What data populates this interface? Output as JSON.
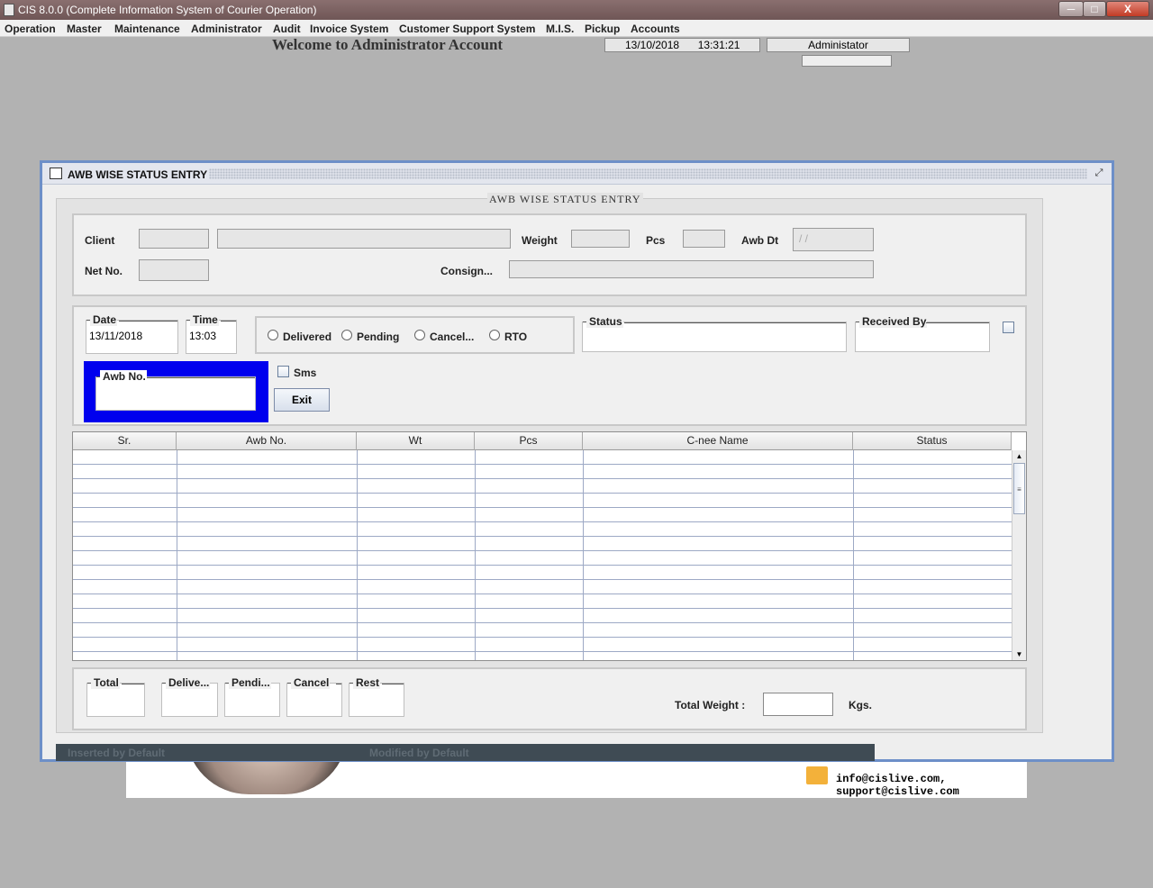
{
  "window": {
    "title": "CIS 8.0.0 (Complete Information System of Courier Operation)",
    "minimize": "─",
    "maximize": "□",
    "close": "X"
  },
  "menu": [
    "Operation",
    "Master",
    "Maintenance",
    "Administrator",
    "Audit",
    "Invoice System",
    "Customer Support System",
    "M.I.S.",
    "Pickup",
    "Accounts"
  ],
  "header": {
    "welcome": "Welcome to Administrator Account",
    "date": "13/10/2018",
    "time": "13:31:21",
    "user": "Administator"
  },
  "banner": {
    "email": "info@cislive.com, support@cislive.com"
  },
  "frame": {
    "title": "AWB WISE STATUS ENTRY",
    "restore": "⤢",
    "group_title": "AWB WISE STATUS ENTRY"
  },
  "details": {
    "client_label": "Client",
    "weight_label": "Weight",
    "pcs_label": "Pcs",
    "awbdt_label": "Awb  Dt",
    "awbdt_value": " / /",
    "netno_label": "Net No.",
    "consign_label": "Consign..."
  },
  "entry": {
    "date_label": "Date",
    "date_value": "13/11/2018",
    "time_label": "Time",
    "time_value": "13:03",
    "radios": [
      "Delivered",
      "Pending",
      "Cancel...",
      "RTO"
    ],
    "status_label": "Status",
    "received_by_label": "Received By",
    "awb_label": "Awb No.",
    "sms_label": "Sms",
    "exit_label": "Exit"
  },
  "table": {
    "columns": [
      "Sr.",
      "Awb No.",
      "Wt",
      "Pcs",
      "C-nee Name",
      "Status"
    ],
    "rows": [],
    "scroll_up": "▲",
    "scroll_down": "▼",
    "thumb_grip": "≡"
  },
  "totals": {
    "total_label": "Total",
    "delivered_label": "Delive...",
    "pending_label": "Pendi...",
    "cancel_label": "Cancel",
    "rest_label": "Rest",
    "total_weight_label": "Total Weight :",
    "unit": "Kgs."
  },
  "status_bar": {
    "inserted": "Inserted by    Default",
    "modified": "Modified by  Default"
  },
  "colors": {
    "awb_highlight": "#0000ee",
    "frame_border": "#6d8fc8"
  }
}
